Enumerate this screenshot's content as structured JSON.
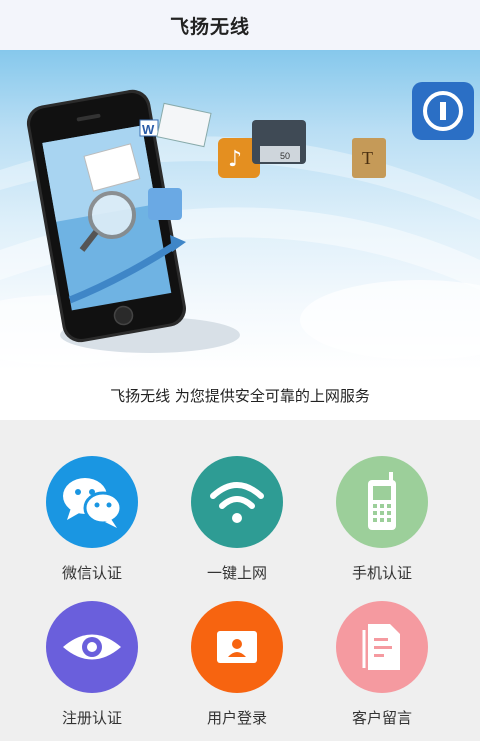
{
  "header": {
    "title": "飞扬无线"
  },
  "banner": {
    "tagline": "飞扬无线 为您提供安全可靠的上网服务"
  },
  "menu": [
    {
      "label": "微信认证",
      "icon": "wechat-icon",
      "color": "#1a96e2"
    },
    {
      "label": "一键上网",
      "icon": "wifi-icon",
      "color": "#2e9c94"
    },
    {
      "label": "手机认证",
      "icon": "mobile-phone-icon",
      "color": "#9ccf9a"
    },
    {
      "label": "注册认证",
      "icon": "eye-icon",
      "color": "#6a5fdc"
    },
    {
      "label": "用户登录",
      "icon": "user-card-icon",
      "color": "#f76410"
    },
    {
      "label": "客户留言",
      "icon": "document-icon",
      "color": "#f59aa0"
    }
  ]
}
